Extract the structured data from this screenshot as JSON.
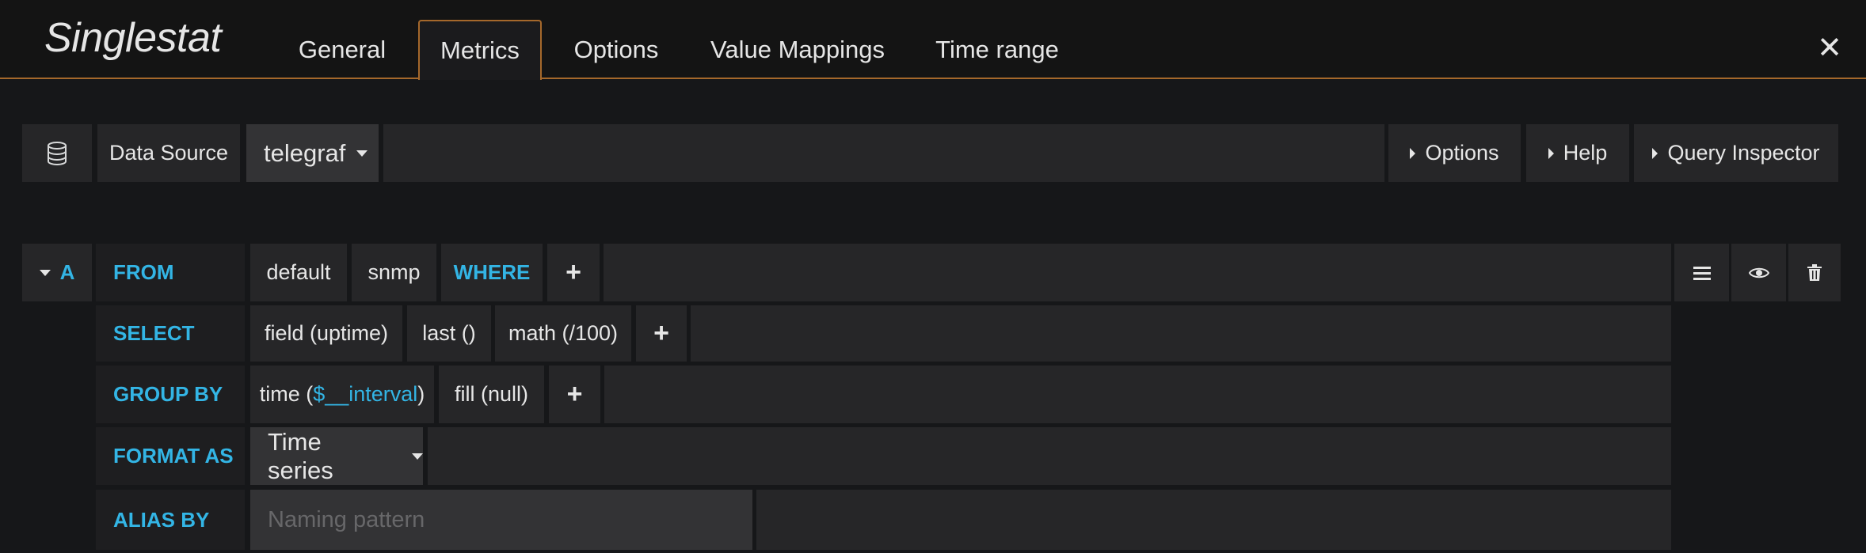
{
  "panel": {
    "title": "Singlestat"
  },
  "tabs": [
    {
      "label": "General"
    },
    {
      "label": "Metrics"
    },
    {
      "label": "Options"
    },
    {
      "label": "Value Mappings"
    },
    {
      "label": "Time range"
    }
  ],
  "active_tab": "Metrics",
  "toolbar": {
    "datasource_label": "Data Source",
    "datasource_value": "telegraf",
    "options_label": "Options",
    "help_label": "Help",
    "query_inspector_label": "Query Inspector"
  },
  "query": {
    "ref_id": "A",
    "from": {
      "keyword": "FROM",
      "policy": "default",
      "measurement": "snmp",
      "where": "WHERE",
      "add": "+"
    },
    "select": {
      "keyword": "SELECT",
      "parts": [
        "field (uptime)",
        "last ()",
        "math (/100)"
      ],
      "add": "+"
    },
    "group_by": {
      "keyword": "GROUP BY",
      "time_prefix": "time (",
      "time_interval": "$__interval",
      "time_suffix": ")",
      "fill": "fill (null)",
      "add": "+"
    },
    "format_as": {
      "keyword": "FORMAT AS",
      "value": "Time series"
    },
    "alias_by": {
      "keyword": "ALIAS BY",
      "placeholder": "Naming pattern"
    }
  },
  "icons": [
    "database-icon",
    "close-icon",
    "menu-icon",
    "eye-icon",
    "trash-icon"
  ],
  "colors": {
    "accent": "#a5682b",
    "keyword": "#33b5e5",
    "background": "#161719"
  }
}
